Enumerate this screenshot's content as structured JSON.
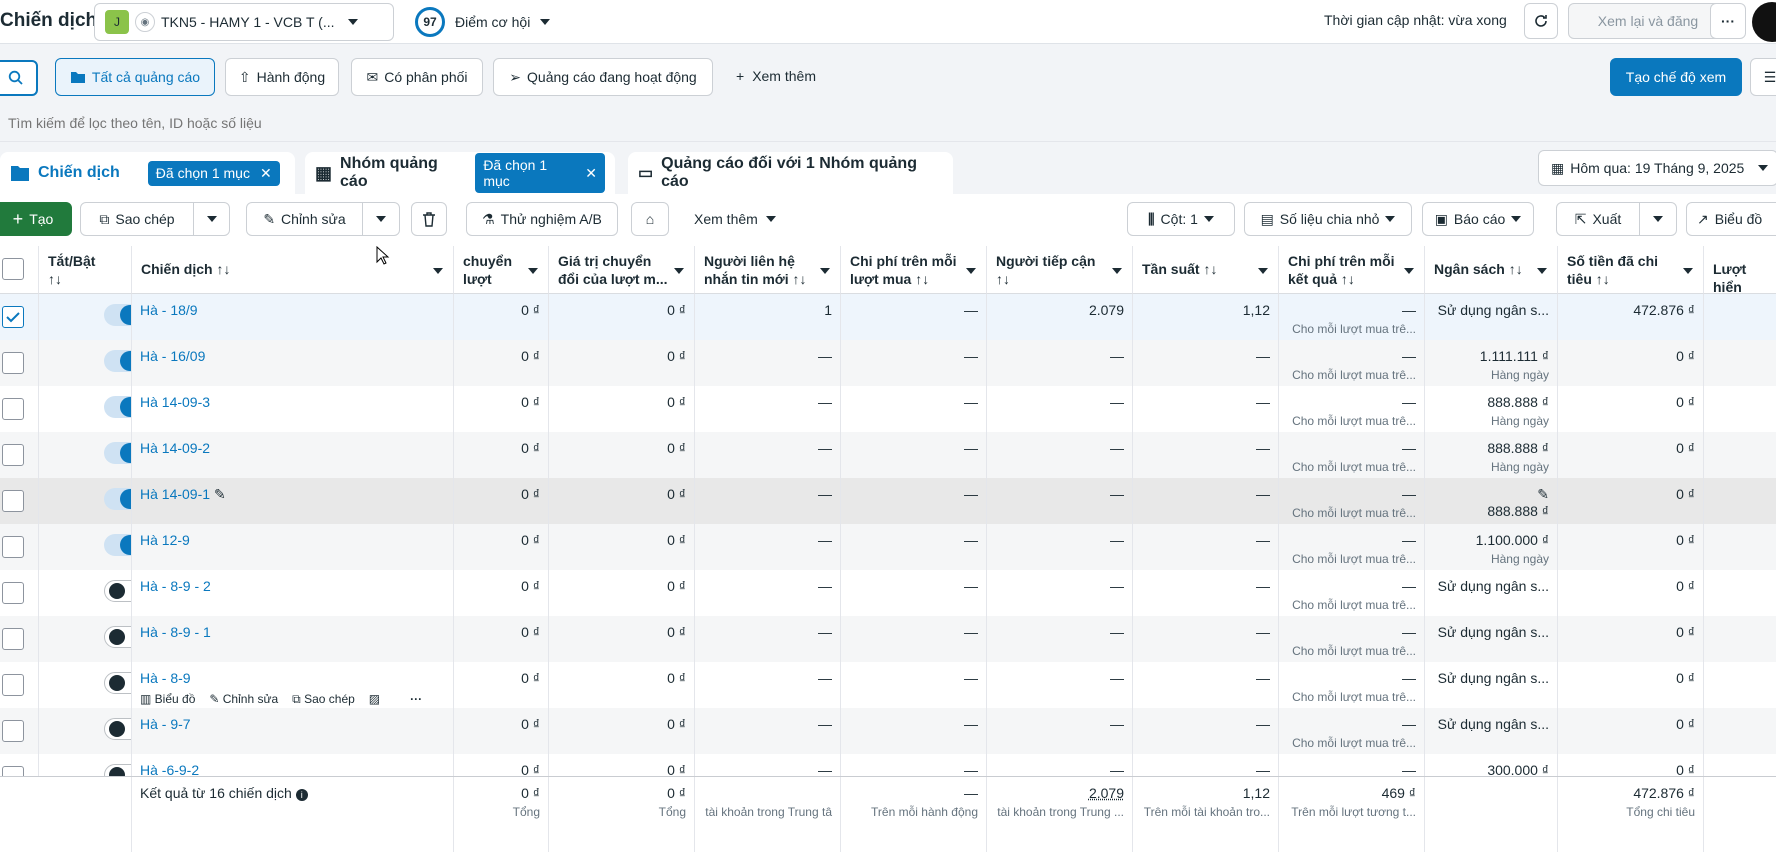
{
  "topbar": {
    "title": "Chiến dịch",
    "account_initial": "J",
    "account_name": "TKN5 - HAMY 1 - VCB T (...",
    "score": "97",
    "score_label": "Điểm cơ hội",
    "update_time": "Thời gian cập nhật: vừa xong",
    "review_publish": "Xem lại và đăng"
  },
  "filters": {
    "all_ads": "Tất cả quảng cáo",
    "actions": "Hành động",
    "delivery": "Có phân phối",
    "active_ads": "Quảng cáo đang hoạt động",
    "more": "Xem thêm",
    "create_view": "Tạo chế độ xem"
  },
  "search": {
    "placeholder": "Tìm kiếm để lọc theo tên, ID hoặc số liệu"
  },
  "tabs": {
    "campaigns": "Chiến dịch",
    "campaigns_selected": "Đã chọn 1 mục",
    "adsets": "Nhóm quảng cáo",
    "adsets_selected": "Đã chọn 1 mục",
    "ads": "Quảng cáo đối với 1 Nhóm quảng cáo",
    "date": "Hôm qua: 19 Tháng 9, 2025"
  },
  "toolbar": {
    "create": "Tạo",
    "duplicate": "Sao chép",
    "edit": "Chỉnh sửa",
    "ab_test": "Thử nghiệm A/B",
    "more": "Xem thêm",
    "columns": "Cột: 1",
    "breakdown": "Số liệu chia nhỏ",
    "reports": "Báo cáo",
    "export": "Xuất",
    "chart": "Biểu đồ"
  },
  "columns": {
    "toggle": "Tắt/Bật ↑↓",
    "name": "Chiến dịch ↑↓",
    "c1": "chuyển lượt mu...",
    "c2": "Giá trị chuyển đổi của lượt m...",
    "c3": "Người liên hệ nhắn tin mới ↑↓",
    "c4": "Chi phí trên mỗi lượt mua ↑↓",
    "c5": "Người tiếp cận ↑↓",
    "c6": "Tần suất ↑↓",
    "c7": "Chi phí trên mỗi kết quả ↑↓",
    "c8": "Ngân sách ↑↓",
    "c9": "Số tiền đã chi tiêu ↑↓",
    "c10": "Lượt hiển"
  },
  "rows": [
    {
      "name": "Hà - 18/9",
      "on": true,
      "checked": true,
      "c1": "0 ₫",
      "c2": "0 ₫",
      "c3": "1",
      "c4": "—",
      "c5": "2.079",
      "c6": "1,12",
      "c7": "—",
      "c7s": "Cho mỗi lượt mua trê...",
      "c8": "Sử dụng ngân s...",
      "c8s": "",
      "c9": "472.876 ₫"
    },
    {
      "name": "Hà - 16/09",
      "on": true,
      "checked": false,
      "c1": "0 ₫",
      "c2": "0 ₫",
      "c3": "—",
      "c4": "—",
      "c5": "—",
      "c6": "—",
      "c7": "—",
      "c7s": "Cho mỗi lượt mua trê...",
      "c8": "1.111.111 ₫",
      "c8s": "Hàng ngày",
      "c9": "0 ₫"
    },
    {
      "name": "Hà 14-09-3",
      "on": true,
      "checked": false,
      "c1": "0 ₫",
      "c2": "0 ₫",
      "c3": "—",
      "c4": "—",
      "c5": "—",
      "c6": "—",
      "c7": "—",
      "c7s": "Cho mỗi lượt mua trê...",
      "c8": "888.888 ₫",
      "c8s": "Hàng ngày",
      "c9": "0 ₫"
    },
    {
      "name": "Hà 14-09-2",
      "on": true,
      "checked": false,
      "c1": "0 ₫",
      "c2": "0 ₫",
      "c3": "—",
      "c4": "—",
      "c5": "—",
      "c6": "—",
      "c7": "—",
      "c7s": "Cho mỗi lượt mua trê...",
      "c8": "888.888 ₫",
      "c8s": "Hàng ngày",
      "c9": "0 ₫"
    },
    {
      "name": "Hà 14-09-1",
      "on": true,
      "checked": false,
      "c1": "0 ₫",
      "c2": "0 ₫",
      "c3": "—",
      "c4": "—",
      "c5": "—",
      "c6": "—",
      "c7": "—",
      "c7s": "Cho mỗi lượt mua trê...",
      "c8": "888.888 ₫",
      "c8s": "",
      "c9": "0 ₫"
    },
    {
      "name": "Hà 12-9",
      "on": true,
      "checked": false,
      "c1": "0 ₫",
      "c2": "0 ₫",
      "c3": "—",
      "c4": "—",
      "c5": "—",
      "c6": "—",
      "c7": "—",
      "c7s": "Cho mỗi lượt mua trê...",
      "c8": "1.100.000 ₫",
      "c8s": "Hàng ngày",
      "c9": "0 ₫"
    },
    {
      "name": "Hà - 8-9 - 2",
      "on": false,
      "checked": false,
      "c1": "0 ₫",
      "c2": "0 ₫",
      "c3": "—",
      "c4": "—",
      "c5": "—",
      "c6": "—",
      "c7": "—",
      "c7s": "Cho mỗi lượt mua trê...",
      "c8": "Sử dụng ngân s...",
      "c8s": "",
      "c9": "0 ₫"
    },
    {
      "name": "Hà - 8-9 - 1",
      "on": false,
      "checked": false,
      "c1": "0 ₫",
      "c2": "0 ₫",
      "c3": "—",
      "c4": "—",
      "c5": "—",
      "c6": "—",
      "c7": "—",
      "c7s": "Cho mỗi lượt mua trê...",
      "c8": "Sử dụng ngân s...",
      "c8s": "",
      "c9": "0 ₫"
    },
    {
      "name": "Hà - 8-9",
      "on": false,
      "checked": false,
      "c1": "0 ₫",
      "c2": "0 ₫",
      "c3": "—",
      "c4": "—",
      "c5": "—",
      "c6": "—",
      "c7": "—",
      "c7s": "Cho mỗi lượt mua trê...",
      "c8": "Sử dụng ngân s...",
      "c8s": "",
      "c9": "0 ₫"
    },
    {
      "name": "Hà - 9-7",
      "on": false,
      "checked": false,
      "c1": "0 ₫",
      "c2": "0 ₫",
      "c3": "—",
      "c4": "—",
      "c5": "—",
      "c6": "—",
      "c7": "—",
      "c7s": "Cho mỗi lượt mua trê...",
      "c8": "Sử dụng ngân s...",
      "c8s": "",
      "c9": "0 ₫"
    },
    {
      "name": "Hà -6-9-2",
      "on": false,
      "checked": false,
      "c1": "0 ₫",
      "c2": "0 ₫",
      "c3": "—",
      "c4": "—",
      "c5": "—",
      "c6": "—",
      "c7": "—",
      "c7s": "",
      "c8": "300.000 ₫",
      "c8s": "",
      "c9": "0 ₫"
    }
  ],
  "row_actions": {
    "chart": "Biểu đồ",
    "edit": "Chỉnh sửa",
    "duplicate": "Sao chép"
  },
  "footer": {
    "label": "Kết quả từ 16 chiến dịch",
    "c1": "0 ₫",
    "c1s": "Tổng",
    "c2": "0 ₫",
    "c2s": "Tổng",
    "c3s": "tài khoản trong Trung tâ",
    "c4": "—",
    "c4s": "Trên mỗi hành động",
    "c5": "2.079",
    "c5s": "tài khoản trong Trung ...",
    "c6": "1,12",
    "c6s": "Trên mỗi tài khoản tro...",
    "c7": "469 ₫",
    "c7s": "Trên mỗi lượt tương t...",
    "c9": "472.876 ₫",
    "c9s": "Tổng chi tiêu"
  },
  "colors": {
    "accent": "#0a78be",
    "create": "#217a3c"
  }
}
